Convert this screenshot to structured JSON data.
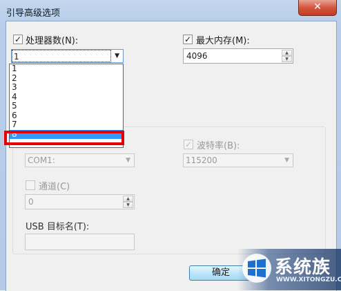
{
  "window": {
    "title": "引导高级选项",
    "close_glyph": "✕"
  },
  "processors": {
    "label": "处理器数(N):",
    "checked": true,
    "selected_value": "1",
    "options": [
      "1",
      "2",
      "3",
      "4",
      "5",
      "6",
      "7",
      "8"
    ],
    "highlighted_option": "8"
  },
  "max_memory": {
    "label": "最大内存(M):",
    "checked": true,
    "value": "4096"
  },
  "debug": {
    "port_value": "COM1:",
    "baud_label": "波特率(B):",
    "baud_checked": true,
    "baud_value": "115200",
    "channel_label": "通道(C)",
    "channel_checked": false,
    "channel_value": "0",
    "usb_label": "USB 目标名(T):",
    "usb_value": ""
  },
  "buttons": {
    "ok": "确定"
  },
  "watermark": {
    "text": "系统族",
    "url": "WWW.XITONGZU.COM"
  },
  "colors": {
    "highlight_border": "#e60000",
    "selection": "#3399ff"
  }
}
